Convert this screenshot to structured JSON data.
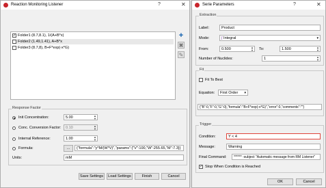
{
  "left": {
    "title": "Reaction Monitoring Listener",
    "help": "?",
    "close": "✕",
    "folders": [
      {
        "label": "Folder1 (8.7,8.1), 1/(A+B*x)",
        "checked": true
      },
      {
        "label": "Folder2 (1.49,1.41), A+B*x",
        "checked": false
      },
      {
        "label": "Folder3 (8.7,8), B+F*exp(-x*G)",
        "checked": false
      }
    ],
    "response_factor": {
      "group_label": "Response Factor",
      "init_conc_label": "Init Concentration:",
      "init_conc_value": "5.00",
      "conc_conv_label": "Conc. Conversion Factor:",
      "conc_conv_value": "0.10",
      "internal_ref_label": "Internal Reference:",
      "internal_ref_value": "1.00",
      "formula_label": "Formula:",
      "formula_button": "...",
      "formula_value": "{\"formula\":\"y*M/(W*V)\",\"params\":{\"V\":100,\"W\":255.65,\"M\":7.3}}",
      "units_label": "Units:",
      "units_value": "mM"
    },
    "buttons": {
      "save_settings": "Save Settings",
      "load_settings": "Load Settings",
      "finish": "Finish",
      "cancel": "Cancel"
    },
    "icons": {
      "add": "+",
      "remove": "✖",
      "edit": "✎"
    },
    "colors": {
      "accent": "#0b5cad",
      "app_icon": "#c8252c"
    }
  },
  "right": {
    "title": "Serie Parameters",
    "help": "?",
    "close": "✕",
    "extraction": {
      "group_label": "Extraction",
      "label_label": "Label:",
      "label_value": "Product",
      "mode_label": "Mode:",
      "mode_value": "Integral",
      "from_label": "From:",
      "from_value": "0.500",
      "to_label": "To:",
      "to_value": "1.500",
      "nuclides_label": "Number of Nuclides:",
      "nuclides_value": "1"
    },
    "fit": {
      "group_label": "Fit",
      "fit_to_best_label": "Fit To Best",
      "equation_label": "Equation:",
      "equation_value": "First Order",
      "json_value": "{\"B\":0,\"F\":0,\"G\":0},\"formula\":\"B+F*exp(-x*G)\",\"error\":0,\"comments\":\"\"}"
    },
    "trigger": {
      "group_label": "Trigger",
      "condition_label": "Condition:",
      "condition_value": "Y < 4",
      "message_label": "Message:",
      "message_value": "Warning",
      "final_command_label": "Final Command:",
      "final_command_value": "****** -subject \"Automatic message from RM Listener\"",
      "stop_label": "Stop When Condition is Reached"
    },
    "buttons": {
      "ok": "OK",
      "cancel": "Cancel"
    }
  }
}
